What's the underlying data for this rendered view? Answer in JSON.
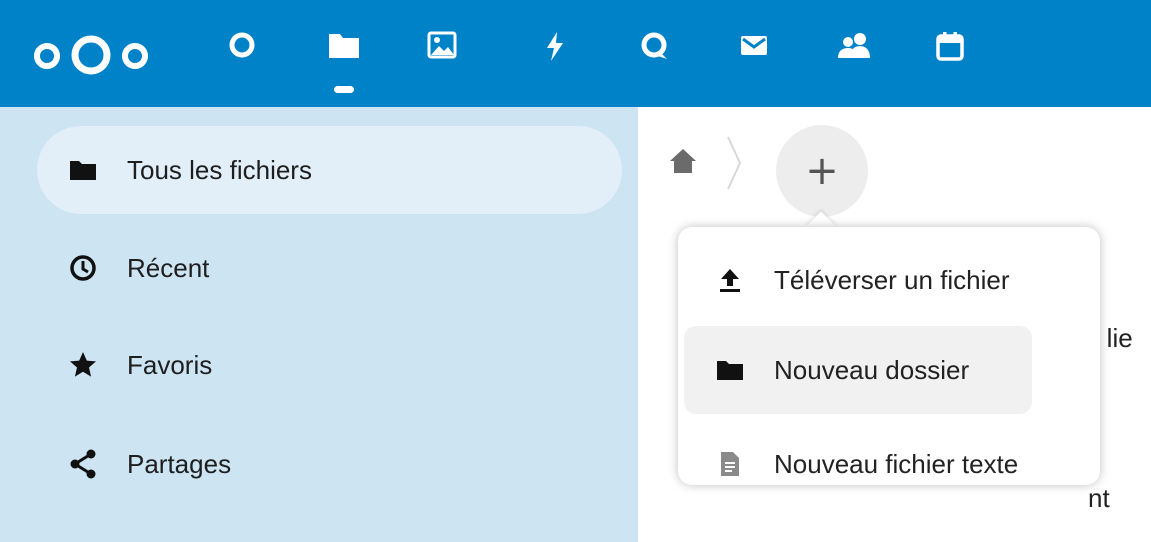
{
  "header": {
    "background_color": "#0082c9",
    "logo": "nextcloud-logo",
    "apps": [
      {
        "name": "dashboard",
        "icon": "circle-icon"
      },
      {
        "name": "files",
        "icon": "folder-icon",
        "active": true
      },
      {
        "name": "photos",
        "icon": "image-icon"
      },
      {
        "name": "activity",
        "icon": "lightning-icon"
      },
      {
        "name": "talk",
        "icon": "chat-icon"
      },
      {
        "name": "mail",
        "icon": "mail-icon"
      },
      {
        "name": "contacts",
        "icon": "contacts-icon"
      },
      {
        "name": "calendar",
        "icon": "calendar-icon"
      }
    ]
  },
  "sidebar": {
    "background_color": "#cde4f3",
    "items": [
      {
        "label": "Tous les fichiers",
        "icon": "folder-icon",
        "active": true
      },
      {
        "label": "Récent",
        "icon": "clock-icon"
      },
      {
        "label": "Favoris",
        "icon": "star-icon"
      },
      {
        "label": "Partages",
        "icon": "share-icon"
      }
    ]
  },
  "main": {
    "breadcrumb": {
      "home_icon": "home-icon",
      "add_label": "+"
    },
    "partial_text": [
      "u lie",
      "nt"
    ]
  },
  "new_menu": {
    "items": [
      {
        "label": "Téléverser un fichier",
        "icon": "upload-icon"
      },
      {
        "label": "Nouveau dossier",
        "icon": "folder-icon",
        "highlighted": true
      },
      {
        "label": "Nouveau fichier texte",
        "icon": "text-file-icon"
      }
    ]
  }
}
